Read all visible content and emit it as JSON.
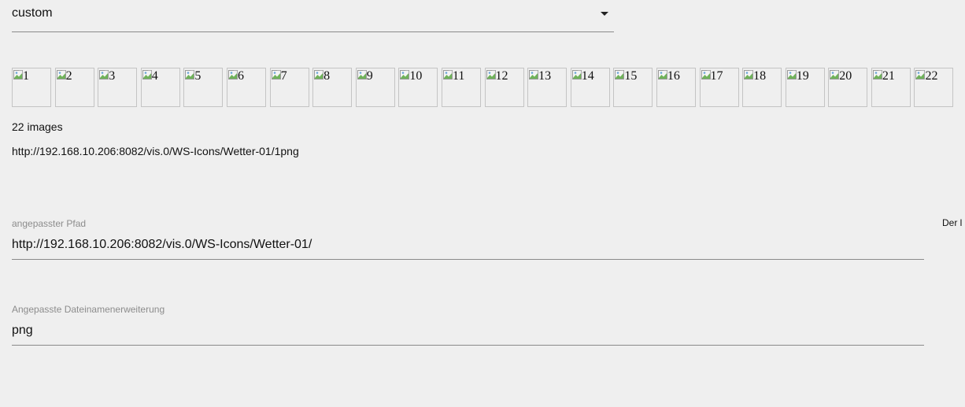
{
  "select": {
    "value": "custom"
  },
  "thumbnails": [
    "1",
    "2",
    "3",
    "4",
    "5",
    "6",
    "7",
    "8",
    "9",
    "10",
    "11",
    "12",
    "13",
    "14",
    "15",
    "16",
    "17",
    "18",
    "19",
    "20",
    "21",
    "22"
  ],
  "images_count_text": "22 images",
  "url_preview": "http://192.168.10.206:8082/vis.0/WS-Icons/Wetter-01/1png",
  "fields": {
    "path": {
      "label": "angepasster Pfad",
      "value": "http://192.168.10.206:8082/vis.0/WS-Icons/Wetter-01/"
    },
    "extension": {
      "label": "Angepasste Dateinamenerweiterung",
      "value": "png"
    }
  },
  "side_text": "Der l",
  "icons": {
    "caret": "chevron-down-icon",
    "broken_image": "broken-image-icon"
  }
}
